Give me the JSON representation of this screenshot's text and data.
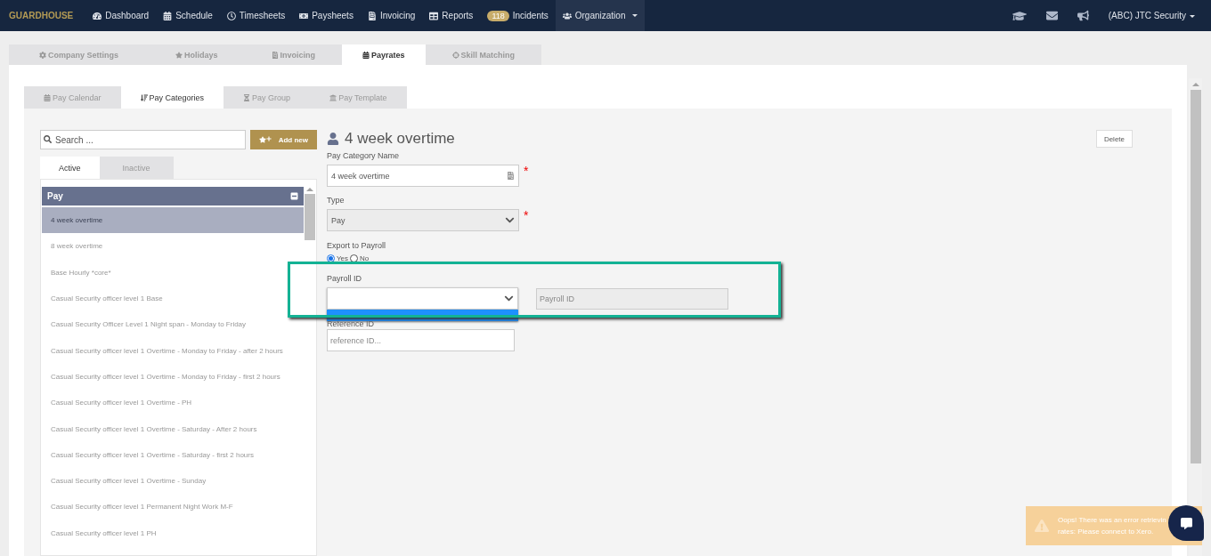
{
  "navbar": {
    "brand": "GUARDHOUSE",
    "items": [
      {
        "label": "Dashboard",
        "selected": false
      },
      {
        "label": "Schedule",
        "selected": false
      },
      {
        "label": "Timesheets",
        "selected": false
      },
      {
        "label": "Paysheets",
        "selected": false
      },
      {
        "label": "Invoicing",
        "selected": false
      },
      {
        "label": "Reports",
        "selected": false
      },
      {
        "label": "Incidents",
        "badge": "118",
        "selected": false
      },
      {
        "label": "Organization",
        "selected": true
      }
    ],
    "user": "(ABC) JTC Security"
  },
  "settings_tabs": [
    {
      "label": "Company Settings",
      "selected": false
    },
    {
      "label": "Holidays",
      "selected": false
    },
    {
      "label": "Invoicing",
      "selected": false
    },
    {
      "label": "Payrates",
      "selected": true
    },
    {
      "label": "Skill Matching",
      "selected": false
    }
  ],
  "payrate_tabs": [
    {
      "label": "Pay Calendar",
      "selected": false
    },
    {
      "label": "Pay Categories",
      "selected": true
    },
    {
      "label": "Pay Group",
      "selected": false
    },
    {
      "label": "Pay Template",
      "selected": false
    }
  ],
  "sidebar": {
    "search": {
      "placeholder": "Search ..."
    },
    "add_button": "Add new",
    "status_tabs": [
      {
        "label": "Active",
        "selected": true
      },
      {
        "label": "Inactive",
        "selected": false
      }
    ],
    "group": {
      "title": "Pay",
      "expanded": true,
      "items": [
        {
          "label": "4 week overtime",
          "selected": true
        },
        {
          "label": "8 week overtime",
          "selected": false
        },
        {
          "label": "Base Hourly *core*",
          "selected": false
        },
        {
          "label": "Casual Security officer level 1 Base",
          "selected": false
        },
        {
          "label": "Casual Security Officer Level 1 Night span - Monday to Friday",
          "selected": false
        },
        {
          "label": "Casual Security officer level 1 Overtime - Monday to Friday - after 2 hours",
          "selected": false
        },
        {
          "label": "Casual Security officer level 1 Overtime - Monday to Friday - first 2 hours",
          "selected": false
        },
        {
          "label": "Casual Security officer level 1 Overtime - PH",
          "selected": false
        },
        {
          "label": "Casual Security officer level 1 Overtime - Saturday - After 2 hours",
          "selected": false
        },
        {
          "label": "Casual Security officer level 1 Overtime - Saturday - first 2 hours",
          "selected": false
        },
        {
          "label": "Casual Security officer level 1 Overtime - Sunday",
          "selected": false
        },
        {
          "label": "Casual Security officer level 1 Permanent Night Work M-F",
          "selected": false
        },
        {
          "label": "Casual Security officer level 1 PH",
          "selected": false
        }
      ]
    }
  },
  "detail": {
    "title": "4 week overtime",
    "delete_button": "Delete",
    "pay_category_name": {
      "label": "Pay Category Name",
      "value": "4 week overtime",
      "required_mark": "*"
    },
    "type": {
      "label": "Type",
      "value": "Pay",
      "required_mark": "*",
      "disabled": true
    },
    "export_to_payroll": {
      "label": "Export to Payroll",
      "options": [
        {
          "label": "Yes",
          "selected": true
        },
        {
          "label": "No",
          "selected": false
        }
      ]
    },
    "payroll_id": {
      "label": "Payroll ID",
      "expanded": true,
      "placeholder": "Payroll ID"
    },
    "reference_id": {
      "label": "Reference ID",
      "placeholder": "reference ID..."
    }
  },
  "toast": {
    "lines": [
      "Oops! There was an error retrievin",
      "rates: Please connect to Xero."
    ]
  }
}
